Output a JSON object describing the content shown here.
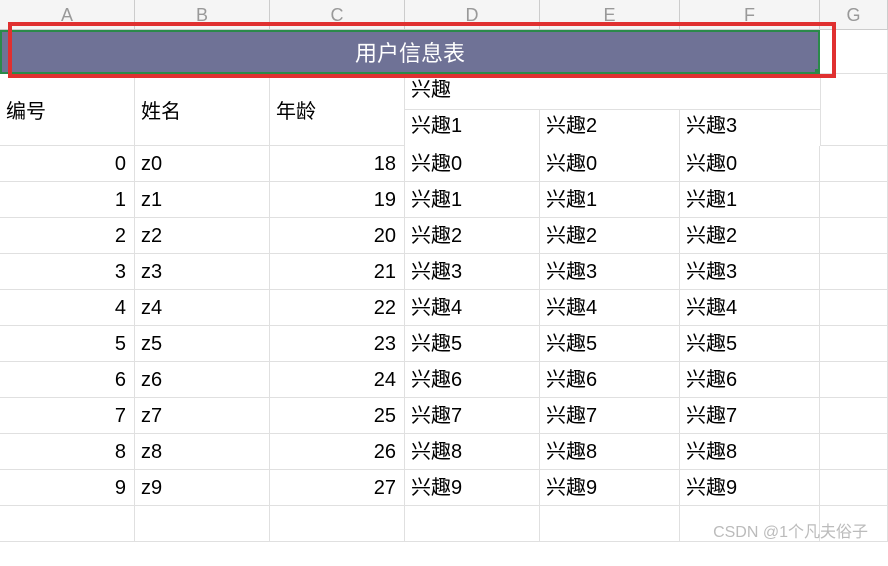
{
  "column_headers": [
    "A",
    "B",
    "C",
    "D",
    "E",
    "F",
    "G"
  ],
  "title": "用户信息表",
  "headers": {
    "id": "编号",
    "name": "姓名",
    "age": "年龄",
    "interest_group": "兴趣",
    "interest1": "兴趣1",
    "interest2": "兴趣2",
    "interest3": "兴趣3"
  },
  "rows": [
    {
      "id": "0",
      "name": "z0",
      "age": "18",
      "i1": "兴趣0",
      "i2": "兴趣0",
      "i3": "兴趣0"
    },
    {
      "id": "1",
      "name": "z1",
      "age": "19",
      "i1": "兴趣1",
      "i2": "兴趣1",
      "i3": "兴趣1"
    },
    {
      "id": "2",
      "name": "z2",
      "age": "20",
      "i1": "兴趣2",
      "i2": "兴趣2",
      "i3": "兴趣2"
    },
    {
      "id": "3",
      "name": "z3",
      "age": "21",
      "i1": "兴趣3",
      "i2": "兴趣3",
      "i3": "兴趣3"
    },
    {
      "id": "4",
      "name": "z4",
      "age": "22",
      "i1": "兴趣4",
      "i2": "兴趣4",
      "i3": "兴趣4"
    },
    {
      "id": "5",
      "name": "z5",
      "age": "23",
      "i1": "兴趣5",
      "i2": "兴趣5",
      "i3": "兴趣5"
    },
    {
      "id": "6",
      "name": "z6",
      "age": "24",
      "i1": "兴趣6",
      "i2": "兴趣6",
      "i3": "兴趣6"
    },
    {
      "id": "7",
      "name": "z7",
      "age": "25",
      "i1": "兴趣7",
      "i2": "兴趣7",
      "i3": "兴趣7"
    },
    {
      "id": "8",
      "name": "z8",
      "age": "26",
      "i1": "兴趣8",
      "i2": "兴趣8",
      "i3": "兴趣8"
    },
    {
      "id": "9",
      "name": "z9",
      "age": "27",
      "i1": "兴趣9",
      "i2": "兴趣9",
      "i3": "兴趣9"
    }
  ],
  "watermark": "CSDN @1个凡夫俗子",
  "chart_data": {
    "type": "table",
    "title": "用户信息表",
    "columns": [
      "编号",
      "姓名",
      "年龄",
      "兴趣1",
      "兴趣2",
      "兴趣3"
    ],
    "data": [
      [
        0,
        "z0",
        18,
        "兴趣0",
        "兴趣0",
        "兴趣0"
      ],
      [
        1,
        "z1",
        19,
        "兴趣1",
        "兴趣1",
        "兴趣1"
      ],
      [
        2,
        "z2",
        20,
        "兴趣2",
        "兴趣2",
        "兴趣2"
      ],
      [
        3,
        "z3",
        21,
        "兴趣3",
        "兴趣3",
        "兴趣3"
      ],
      [
        4,
        "z4",
        22,
        "兴趣4",
        "兴趣4",
        "兴趣4"
      ],
      [
        5,
        "z5",
        23,
        "兴趣5",
        "兴趣5",
        "兴趣5"
      ],
      [
        6,
        "z6",
        24,
        "兴趣6",
        "兴趣6",
        "兴趣6"
      ],
      [
        7,
        "z7",
        25,
        "兴趣7",
        "兴趣7",
        "兴趣7"
      ],
      [
        8,
        "z8",
        26,
        "兴趣8",
        "兴趣8",
        "兴趣8"
      ],
      [
        9,
        "z9",
        27,
        "兴趣9",
        "兴趣9",
        "兴趣9"
      ]
    ]
  }
}
